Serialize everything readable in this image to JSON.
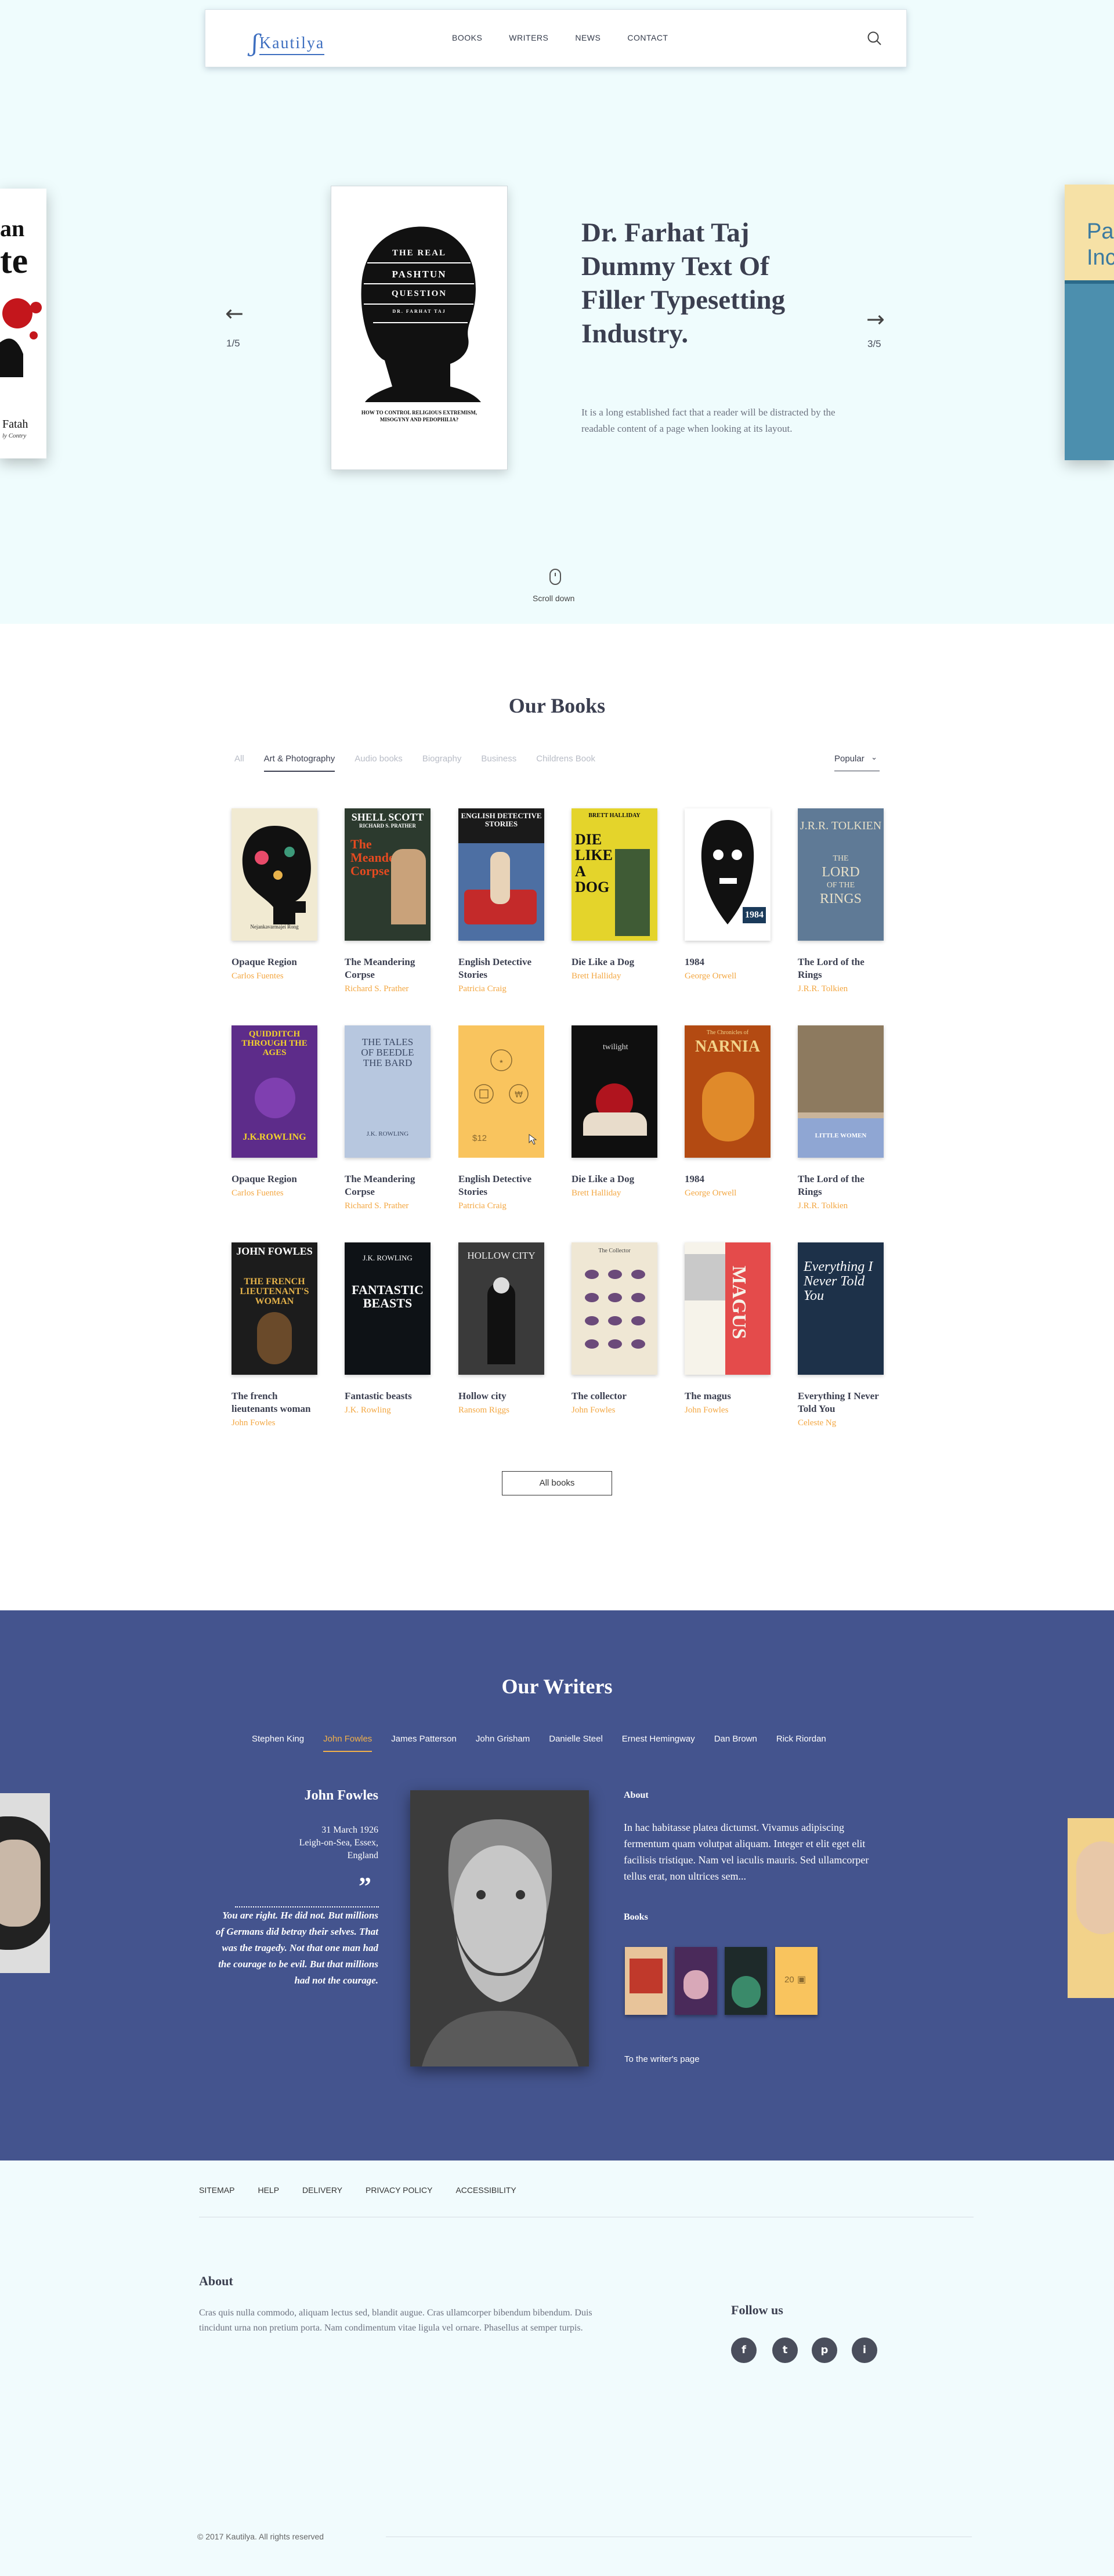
{
  "header": {
    "logo_mark": "ʃ",
    "logo_text": "Kautilya",
    "menu": [
      "BOOKS",
      "WRITERS",
      "NEWS",
      "CONTACT"
    ]
  },
  "hero": {
    "counter_left": "1/5",
    "counter_right": "3/5",
    "title": "Dr. Farhat Taj Dummy Text Of Filler Typesetting Industry.",
    "text": "It is a long established fact that a reader will be distracted by the readable content of a page when looking at its layout.",
    "scroll_label": "Scroll down",
    "main_cover": {
      "top": "THE REAL",
      "band": "PASHTUN",
      "bottom": "QUESTION",
      "author": "DR. FARHAT TAJ",
      "subtitle": "HOW TO CONTROL RELIGIOUS EXTREMISM, MISOGYNY AND PEDOPHILIA?"
    },
    "left_cover": {
      "line1": "an",
      "line2": "te",
      "line3": "Fatah",
      "line4": "ly Contry"
    },
    "right_cover": {
      "line1": "Pa",
      "line2": "Inc"
    }
  },
  "books": {
    "title": "Our Books",
    "filters": [
      "All",
      "Art & Photography",
      "Audio books",
      "Biography",
      "Business",
      "Childrens Book"
    ],
    "active_filter": 1,
    "sort_label": "Popular",
    "all_button": "All books",
    "hover_price": "$12",
    "items": [
      {
        "title": "Opaque Region",
        "author": "Carlos Fuentes",
        "cover": "Nejankavarmajei Rong"
      },
      {
        "title": "The Meandering Corpse",
        "author": "Richard S. Prather",
        "cover": "SHELL SCOTT"
      },
      {
        "title": "English Detective Stories",
        "author": "Patricia Craig",
        "cover": "ENGLISH DETECTIVE STORIES"
      },
      {
        "title": "Die Like a Dog",
        "author": "Brett Halliday",
        "cover": "DIE LIKE A DOG"
      },
      {
        "title": "1984",
        "author": "George Orwell",
        "cover": "1984"
      },
      {
        "title": "The Lord of the Rings",
        "author": "J.R.R. Tolkien",
        "cover": "J.R.R. TOLKIEN"
      },
      {
        "title": "Opaque Region",
        "author": "Carlos Fuentes",
        "cover": "QUIDDITCH THROUGH THE AGES"
      },
      {
        "title": "The Meandering Corpse",
        "author": "Richard S. Prather",
        "cover": "THE TALES OF BEEDLE THE BARD"
      },
      {
        "title": "English Detective Stories",
        "author": "Patricia Craig",
        "cover": ""
      },
      {
        "title": "Die Like a Dog",
        "author": "Brett Halliday",
        "cover": "twilight"
      },
      {
        "title": "1984",
        "author": "George Orwell",
        "cover": "NARNIA"
      },
      {
        "title": "The Lord of the Rings",
        "author": "J.R.R. Tolkien",
        "cover": "LITTLE WOMEN"
      },
      {
        "title": "The french lieutenants woman",
        "author": "John Fowles",
        "cover": "JOHN FOWLES"
      },
      {
        "title": "Fantastic beasts",
        "author": "J.K. Rowling",
        "cover": "FANTASTIC BEASTS"
      },
      {
        "title": "Hollow city",
        "author": "Ransom Riggs",
        "cover": "HOLLOW CITY"
      },
      {
        "title": "The collector",
        "author": "John Fowles",
        "cover": "The Collector"
      },
      {
        "title": "The magus",
        "author": "John Fowles",
        "cover": "MAGUS"
      },
      {
        "title": "Everything I Never Told You",
        "author": "Celeste Ng",
        "cover": "Everything I Never Told You"
      }
    ]
  },
  "writers": {
    "title": "Our Writers",
    "tabs": [
      "Stephen King",
      "John Fowles",
      "James Patterson",
      "John Grisham",
      "Danielle Steel",
      "Ernest Hemingway",
      "Dan Brown",
      "Rick Riordan"
    ],
    "active_tab": 1,
    "name": "John Fowles",
    "birth": "31 March 1926\nLeigh-on-Sea, Essex,\nEngland",
    "quote_mark": "”",
    "quote": "You are right. He did not. But millions of Germans did betray their selves. That was the tragedy. Not that one man had the courage to be evil. But that millions had not the courage.",
    "about_label": "About",
    "about_text": "In hac habitasse platea dictumst. Vivamus adipiscing fermentum quam volutpat aliquam. Integer et elit eget elit facilisis tristique. Nam vel iaculis mauris. Sed ullamcorper tellus erat, non ultrices sem...",
    "books_label": "Books",
    "more_books": "20",
    "link": "To the writer's page"
  },
  "footer": {
    "links": [
      "SITEMAP",
      "HELP",
      "DELIVERY",
      "PRIVACY POLICY",
      "ACCESSIBILITY"
    ],
    "about_title": "About",
    "about_text": "Cras quis nulla commodo, aliquam lectus sed, blandit augue. Cras ullamcorper bibendum bibendum. Duis tincidunt urna non pretium porta. Nam condimentum vitae ligula vel ornare. Phasellus at semper turpis.",
    "follow_title": "Follow us",
    "social": [
      "f",
      "t",
      "p",
      "i"
    ],
    "copyright": "© 2017 Kautilya. All rights reserved"
  },
  "colors": {
    "accent": "#f3a742",
    "writers_bg": "#44548e",
    "bg": "#effcfd",
    "brand": "#3e6fc0"
  }
}
